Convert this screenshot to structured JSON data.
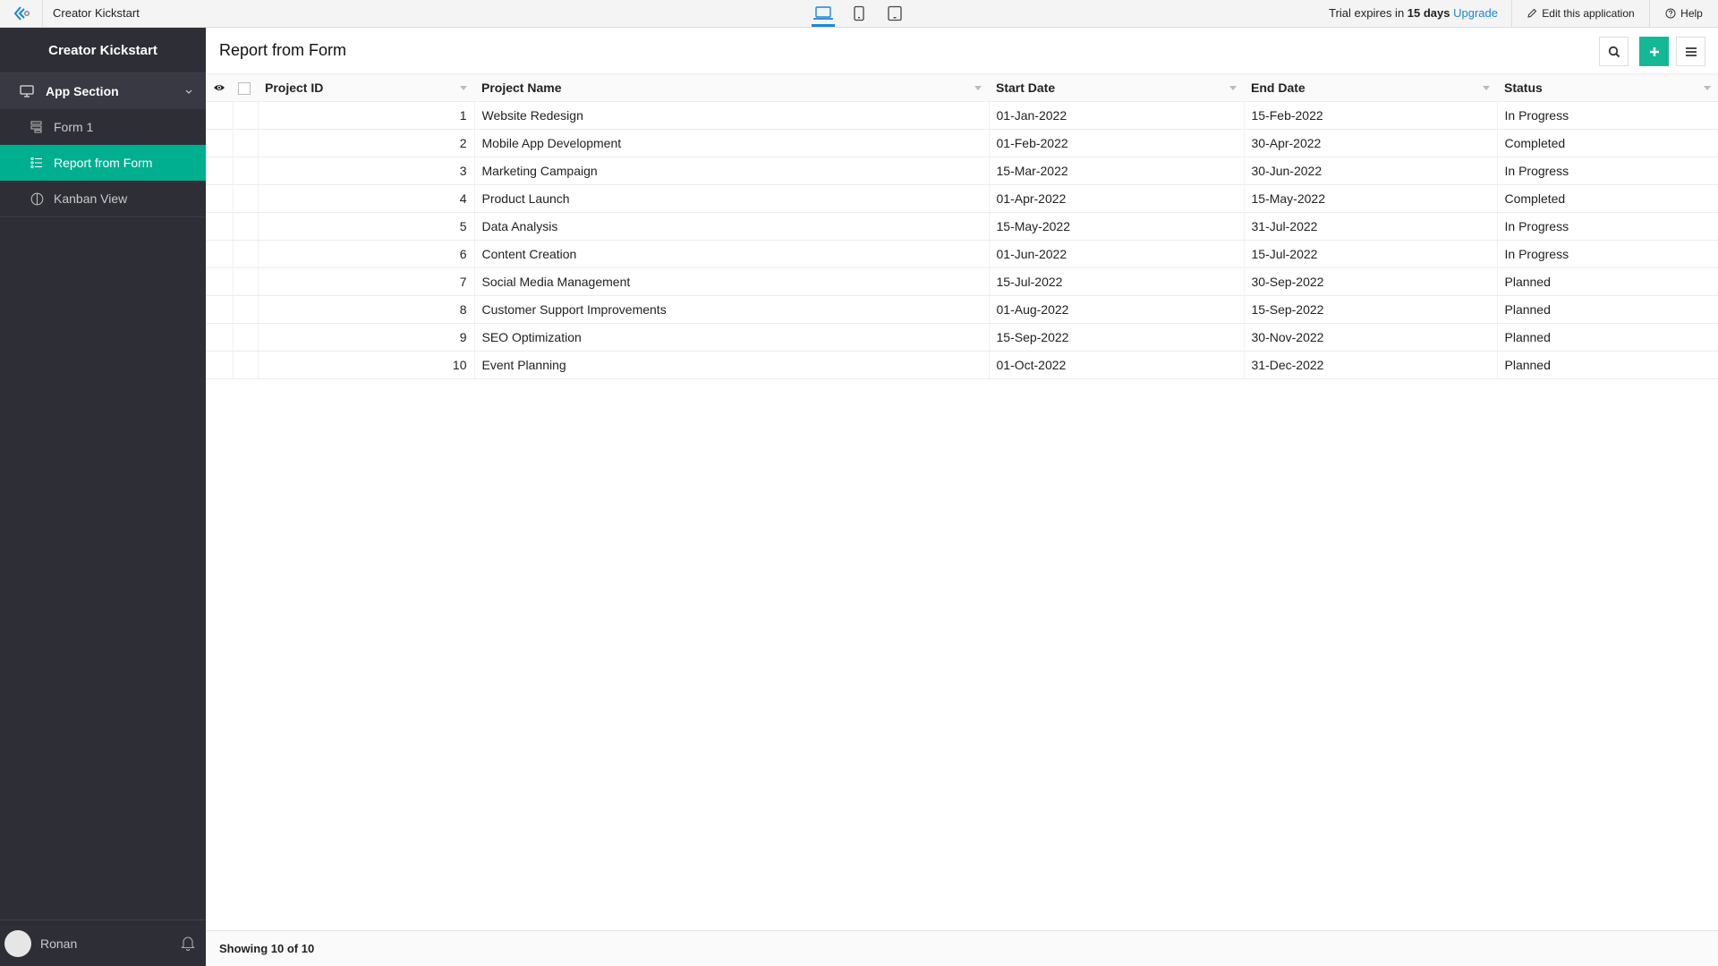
{
  "topbar": {
    "app_title": "Creator Kickstart",
    "devices": [
      {
        "name": "desktop",
        "active": true
      },
      {
        "name": "tablet",
        "active": false
      },
      {
        "name": "mobile",
        "active": false
      }
    ],
    "trial_prefix": "Trial expires in",
    "trial_days": "15 days",
    "upgrade_label": "Upgrade",
    "edit_label": "Edit this application",
    "help_label": "Help",
    "accent_color": "#1a87d6"
  },
  "sidebar": {
    "title": "Creator Kickstart",
    "section_label": "App Section",
    "items": [
      {
        "label": "Form 1",
        "icon": "form-icon",
        "active": false
      },
      {
        "label": "Report from Form",
        "icon": "list-report-icon",
        "active": true
      },
      {
        "label": "Kanban View",
        "icon": "kanban-icon",
        "active": false
      }
    ],
    "user_name": "Ronan",
    "active_color": "#00ae90"
  },
  "main": {
    "page_title": "Report from Form",
    "columns": [
      "Project ID",
      "Project Name",
      "Start Date",
      "End Date",
      "Status"
    ],
    "rows": [
      {
        "id": "1",
        "name": "Website Redesign",
        "start": "01-Jan-2022",
        "end": "15-Feb-2022",
        "status": "In Progress"
      },
      {
        "id": "2",
        "name": "Mobile App Development",
        "start": "01-Feb-2022",
        "end": "30-Apr-2022",
        "status": "Completed"
      },
      {
        "id": "3",
        "name": "Marketing Campaign",
        "start": "15-Mar-2022",
        "end": "30-Jun-2022",
        "status": "In Progress"
      },
      {
        "id": "4",
        "name": "Product Launch",
        "start": "01-Apr-2022",
        "end": "15-May-2022",
        "status": "Completed"
      },
      {
        "id": "5",
        "name": "Data Analysis",
        "start": "15-May-2022",
        "end": "31-Jul-2022",
        "status": "In Progress"
      },
      {
        "id": "6",
        "name": "Content Creation",
        "start": "01-Jun-2022",
        "end": "15-Jul-2022",
        "status": "In Progress"
      },
      {
        "id": "7",
        "name": "Social Media Management",
        "start": "15-Jul-2022",
        "end": "30-Sep-2022",
        "status": "Planned"
      },
      {
        "id": "8",
        "name": "Customer Support Improvements",
        "start": "01-Aug-2022",
        "end": "15-Sep-2022",
        "status": "Planned"
      },
      {
        "id": "9",
        "name": "SEO Optimization",
        "start": "15-Sep-2022",
        "end": "30-Nov-2022",
        "status": "Planned"
      },
      {
        "id": "10",
        "name": "Event Planning",
        "start": "01-Oct-2022",
        "end": "31-Dec-2022",
        "status": "Planned"
      }
    ],
    "footer_text": "Showing 10 of 10",
    "add_button_color": "#14b895"
  }
}
